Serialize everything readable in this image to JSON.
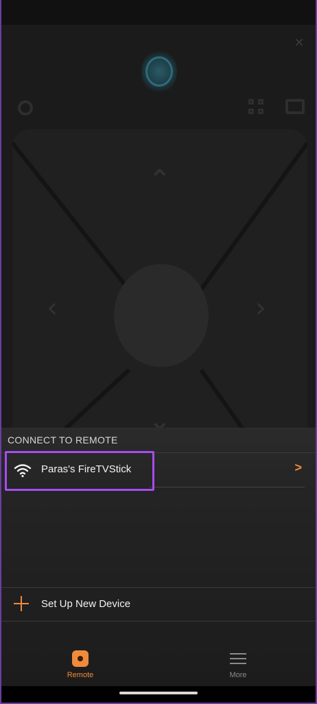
{
  "sheet": {
    "header": "CONNECT TO REMOTE",
    "device": {
      "name": "Paras's FireTVStick"
    },
    "setup_label": "Set Up New Device"
  },
  "tabbar": {
    "remote_label": "Remote",
    "more_label": "More"
  },
  "icons": {
    "close": "close-icon",
    "alexa": "alexa-icon",
    "settings": "settings-icon",
    "apps": "apps-icon",
    "keyboard": "keyboard-icon",
    "wifi": "wifi-icon",
    "chevron": "chevron-right-icon",
    "plus": "plus-icon",
    "remote": "remote-tab-icon",
    "menu": "menu-tab-icon"
  },
  "colors": {
    "accent": "#f08a3c",
    "highlight": "#a64cf2",
    "background": "#1b1b1b"
  }
}
